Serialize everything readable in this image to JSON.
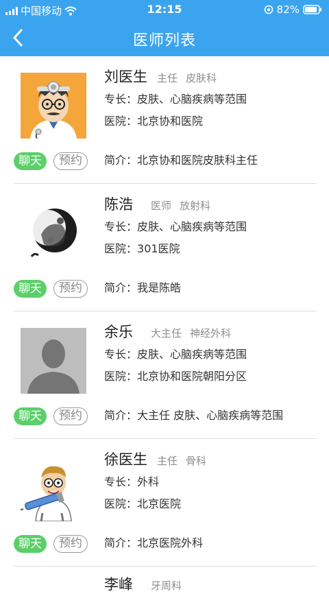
{
  "status_bar": {
    "carrier": "中国移动",
    "time": "12:15",
    "battery": "82%"
  },
  "nav": {
    "title": "医师列表"
  },
  "labels": {
    "chat": "聊天",
    "book": "预约",
    "specialty": "专长：",
    "hospital": "医院：",
    "intro": "简介："
  },
  "colors": {
    "primary": "#3ba4ee",
    "chat_green": "#5ccf6a"
  },
  "doctors": [
    {
      "name": "刘医生",
      "title": "主任",
      "dept": "皮肤科",
      "specialty": "皮肤、心脑疾病等范围",
      "hospital": "北京协和医院",
      "intro": "北京协和医院皮肤科主任",
      "avatar": "cartoon-doctor-avatar"
    },
    {
      "name": "陈浩",
      "title": "医师",
      "dept": "放射科",
      "specialty": "皮肤、心脑疾病等范围",
      "hospital": "301医院",
      "intro": "我是陈皓",
      "avatar": "ink-moon-avatar"
    },
    {
      "name": "余乐",
      "title": "大主任",
      "dept": "神经外科",
      "specialty": "皮肤、心脑疾病等范围",
      "hospital": "北京协和医院朝阳分区",
      "intro": "大主任 皮肤、心脑疾病等范围",
      "avatar": "default-person-avatar"
    },
    {
      "name": "徐医生",
      "title": "主任",
      "dept": "骨科",
      "specialty": "外科",
      "hospital": "北京医院",
      "intro": "北京医院外科",
      "avatar": "cartoon-syringe-doctor-avatar"
    }
  ],
  "partial_doctor": {
    "name": "李峰",
    "dept": "牙周科"
  }
}
